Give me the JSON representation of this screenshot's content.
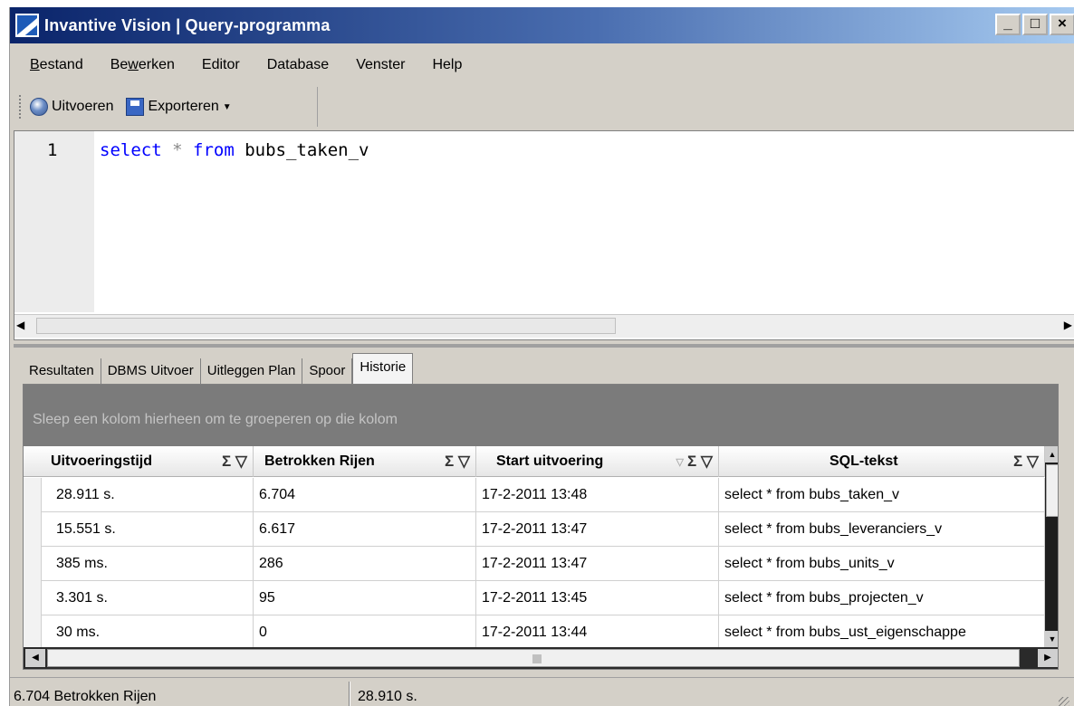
{
  "window": {
    "title": "Invantive Vision | Query-programma",
    "minimize": "_",
    "maximize": "□",
    "close": "×"
  },
  "menu": {
    "items": [
      {
        "label": "Bestand",
        "accel_index": 0
      },
      {
        "label": "Bewerken",
        "accel_index": 2
      },
      {
        "label": "Editor",
        "accel_index": -1
      },
      {
        "label": "Database",
        "accel_index": -1
      },
      {
        "label": "Venster",
        "accel_index": -1
      },
      {
        "label": "Help",
        "accel_index": -1
      }
    ]
  },
  "toolbar": {
    "run_label": "Uitvoeren",
    "export_label": "Exporteren",
    "export_arrow": "▼"
  },
  "editor": {
    "line_number": "1",
    "code": {
      "kw1": "select",
      "star": "*",
      "kw2": "from",
      "ident": "bubs_taken_v"
    },
    "scroll_left": "◀",
    "scroll_right": "▶"
  },
  "tabs": [
    {
      "label": "Resultaten",
      "active": false
    },
    {
      "label": "DBMS Uitvoer",
      "active": false
    },
    {
      "label": "Uitleggen Plan",
      "active": false
    },
    {
      "label": "Spoor",
      "active": false
    },
    {
      "label": "Historie",
      "active": true
    }
  ],
  "grid": {
    "group_hint": "Sleep een kolom hierheen om te groeperen op die kolom",
    "columns": [
      {
        "label": "Uitvoeringstijd",
        "icons": "Σ ▽"
      },
      {
        "label": "Betrokken Rijen",
        "icons": "Σ ▽"
      },
      {
        "label": "Start uitvoering",
        "icons": "Σ ▽"
      },
      {
        "label": "SQL-tekst",
        "icons": "Σ ▽"
      }
    ],
    "rows": [
      [
        "28.911 s.",
        "6.704",
        "17-2-2011 13:48",
        "select * from bubs_taken_v"
      ],
      [
        "15.551 s.",
        "6.617",
        "17-2-2011 13:47",
        "select * from bubs_leveranciers_v"
      ],
      [
        "385 ms.",
        "286",
        "17-2-2011 13:47",
        "select * from bubs_units_v"
      ],
      [
        "3.301 s.",
        "95",
        "17-2-2011 13:45",
        "select * from bubs_projecten_v"
      ],
      [
        "30 ms.",
        "0",
        "17-2-2011 13:44",
        "select * from bubs_ust_eigenschappe"
      ]
    ],
    "scroll_up": "▲",
    "scroll_down": "▼",
    "scroll_left": "◀",
    "scroll_right": "▶"
  },
  "statusbar": {
    "rows_affected": "6.704 Betrokken Rijen",
    "duration": "28.910 s."
  }
}
